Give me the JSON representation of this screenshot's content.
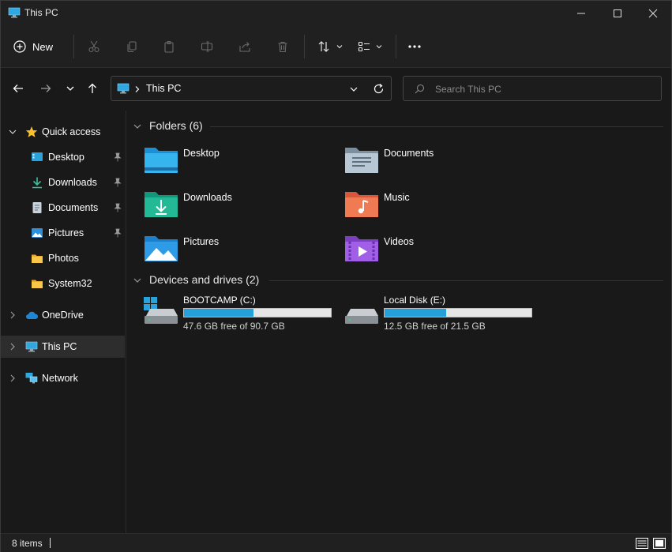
{
  "window": {
    "title": "This PC",
    "controls": [
      "minimize",
      "maximize",
      "close"
    ]
  },
  "command_bar": {
    "new_label": "New",
    "buttons": [
      "cut-icon",
      "copy-icon",
      "paste-icon",
      "rename-icon",
      "share-icon",
      "delete-icon",
      "sort-icon",
      "view-icon",
      "more-icon"
    ]
  },
  "address": {
    "breadcrumb": "This PC",
    "search_placeholder": "Search This PC"
  },
  "sidebar": {
    "quick_access": "Quick access",
    "items": [
      {
        "label": "Desktop",
        "pinned": true
      },
      {
        "label": "Downloads",
        "pinned": true
      },
      {
        "label": "Documents",
        "pinned": true
      },
      {
        "label": "Pictures",
        "pinned": true
      },
      {
        "label": "Photos",
        "pinned": false
      },
      {
        "label": "System32",
        "pinned": false
      }
    ],
    "onedrive": "OneDrive",
    "this_pc": "This PC",
    "network": "Network"
  },
  "content": {
    "folders_header": "Folders (6)",
    "folders": [
      {
        "name": "Desktop",
        "icon": "desktop-folder-icon"
      },
      {
        "name": "Documents",
        "icon": "documents-folder-icon"
      },
      {
        "name": "Downloads",
        "icon": "downloads-folder-icon"
      },
      {
        "name": "Music",
        "icon": "music-folder-icon"
      },
      {
        "name": "Pictures",
        "icon": "pictures-folder-icon"
      },
      {
        "name": "Videos",
        "icon": "videos-folder-icon"
      }
    ],
    "drives_header": "Devices and drives (2)",
    "drives": [
      {
        "name": "BOOTCAMP (C:)",
        "free": "47.6 GB free of 90.7 GB",
        "used_fraction": 0.475
      },
      {
        "name": "Local Disk (E:)",
        "free": "12.5 GB free of 21.5 GB",
        "used_fraction": 0.419
      }
    ]
  },
  "status": {
    "items": "8 items"
  },
  "colors": {
    "accent": "#26a0da",
    "background": "#191919",
    "chrome": "#202020"
  }
}
